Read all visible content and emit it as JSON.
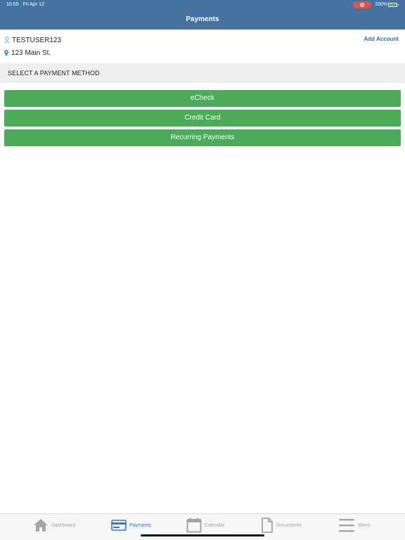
{
  "status_bar": {
    "time": "10:05",
    "date": "Fri Apr 12",
    "battery_percent": "100%",
    "battery_icon": "battery-charging-icon",
    "record_icon": "screen-record-icon",
    "record_color": "#e0534a"
  },
  "header": {
    "title": "Payments",
    "background_color": "#4672a1"
  },
  "account": {
    "name": "TESTUSER123",
    "name_icon": "user-icon",
    "address": "123 Main St.",
    "address_icon": "location-pin-icon",
    "add_account_label": "Add Account"
  },
  "section": {
    "title": "SELECT A PAYMENT METHOD"
  },
  "payment_methods": [
    {
      "label": "eCheck"
    },
    {
      "label": "Credit Card"
    },
    {
      "label": "Recurring Payments"
    }
  ],
  "button_color": "#4caa58",
  "tabbar": {
    "active_color": "#2e7bd6",
    "inactive_color": "#a5a5a5",
    "items": [
      {
        "label": "Dashboard",
        "icon": "home-icon",
        "active": false
      },
      {
        "label": "Payments",
        "icon": "credit-card-icon",
        "active": true
      },
      {
        "label": "Calendar",
        "icon": "calendar-icon",
        "active": false
      },
      {
        "label": "Documents",
        "icon": "document-icon",
        "active": false
      },
      {
        "label": "Menu",
        "icon": "hamburger-menu-icon",
        "active": false
      }
    ]
  }
}
